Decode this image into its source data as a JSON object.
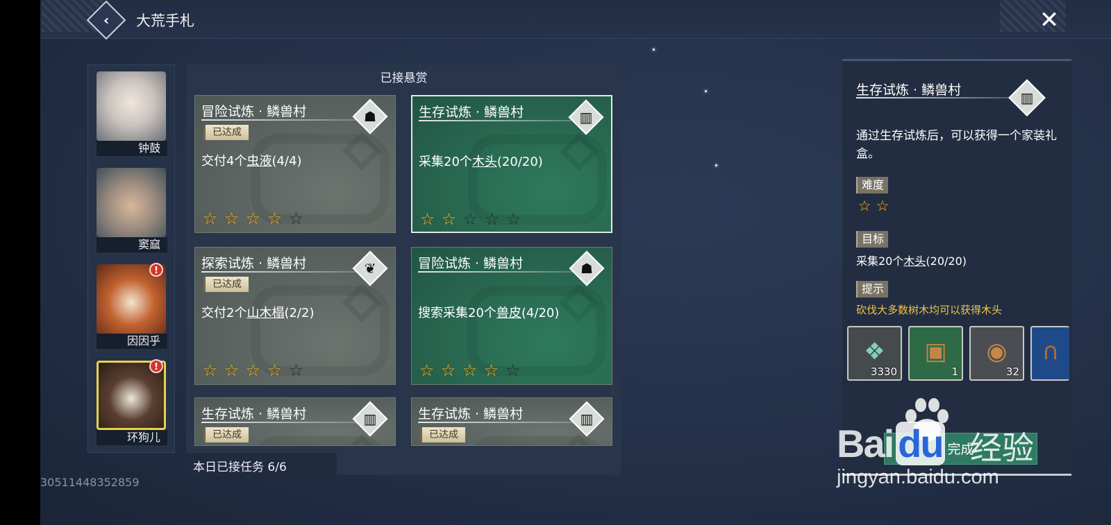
{
  "header": {
    "title": "大荒手札",
    "back_glyph": "‹",
    "close_glyph": "✕"
  },
  "characters": [
    {
      "name": "钟鼓",
      "alert": false,
      "selected": false,
      "avatar": "white-haired-woman"
    },
    {
      "name": "窦窳",
      "alert": false,
      "selected": false,
      "avatar": "silver-haired-man"
    },
    {
      "name": "因因乎",
      "alert": true,
      "selected": false,
      "avatar": "red-panda"
    },
    {
      "name": "环狗儿",
      "alert": true,
      "selected": true,
      "avatar": "raccoon"
    }
  ],
  "alert_glyph": "!",
  "main": {
    "heading": "已接悬赏",
    "daily_count": "本日已接任务 6/6"
  },
  "quests": [
    {
      "title": "冒险试炼 · 鳞兽村",
      "badge": "已达成",
      "obj_pre": "交付4个",
      "obj_item": "虫液",
      "obj_post": "(4/4)",
      "stars": 4,
      "theme": "gray",
      "icon": "mask-icon",
      "icon_glyph": "☗"
    },
    {
      "title": "生存试炼 · 鳞兽村",
      "badge": "",
      "obj_pre": "采集20个",
      "obj_item": "木头",
      "obj_post": "(20/20)",
      "stars": 2,
      "theme": "green",
      "icon": "scroll-icon",
      "icon_glyph": "▥",
      "active": true
    },
    {
      "title": "探索试炼 · 鳞兽村",
      "badge": "已达成",
      "obj_pre": "交付2个",
      "obj_item": "山木榻",
      "obj_post": "(2/2)",
      "stars": 4,
      "theme": "gray",
      "icon": "beast-icon",
      "icon_glyph": "❦"
    },
    {
      "title": "冒险试炼 · 鳞兽村",
      "badge": "",
      "obj_pre": "搜索采集20个",
      "obj_item": "兽皮",
      "obj_post": "(4/20)",
      "stars": 4,
      "theme": "green",
      "icon": "mask-icon",
      "icon_glyph": "☗"
    },
    {
      "title": "生存试炼 · 鳞兽村",
      "badge": "已达成",
      "obj_pre": "",
      "obj_item": "",
      "obj_post": "",
      "stars": 0,
      "theme": "gray",
      "icon": "scroll-icon",
      "icon_glyph": "▥"
    },
    {
      "title": "生存试炼 · 鳞兽村",
      "badge": "已达成",
      "obj_pre": "",
      "obj_item": "",
      "obj_post": "",
      "stars": 0,
      "theme": "gray",
      "icon": "scroll-icon",
      "icon_glyph": "▥"
    }
  ],
  "star_glyph": "☆",
  "detail": {
    "title": "生存试炼 · 鳞兽村",
    "icon_glyph": "▥",
    "description": "通过生存试炼后，可以获得一个家装礼盒。",
    "difficulty_label": "难度",
    "difficulty": 2,
    "goal_label": "目标",
    "goal_pre": "采集20个",
    "goal_item": "木头",
    "goal_post": "(20/20)",
    "hint_label": "提示",
    "hint": "砍伐大多数树木均可以获得木头",
    "rewards": [
      {
        "count": "3330",
        "icon": "jade-crystal-icon",
        "glyph": "❖",
        "color": "#7fd1b9",
        "bg": "#454a4c"
      },
      {
        "count": "1",
        "icon": "treasure-chest-icon",
        "glyph": "▣",
        "color": "#c6844a",
        "bg": "#2e6a45"
      },
      {
        "count": "32",
        "icon": "bronze-coin-icon",
        "glyph": "◉",
        "color": "#c8874a",
        "bg": "#4a4e52"
      },
      {
        "count": "",
        "icon": "horseshoe-icon",
        "glyph": "∩",
        "color": "#b06a3a",
        "bg": "#1f4a8a"
      }
    ],
    "complete_label": "完成"
  },
  "uid": "30511448352859",
  "watermark": {
    "brand_left": "Bai",
    "brand_right": "du",
    "brand_jy": "经验",
    "url": "jingyan.baidu.com"
  }
}
